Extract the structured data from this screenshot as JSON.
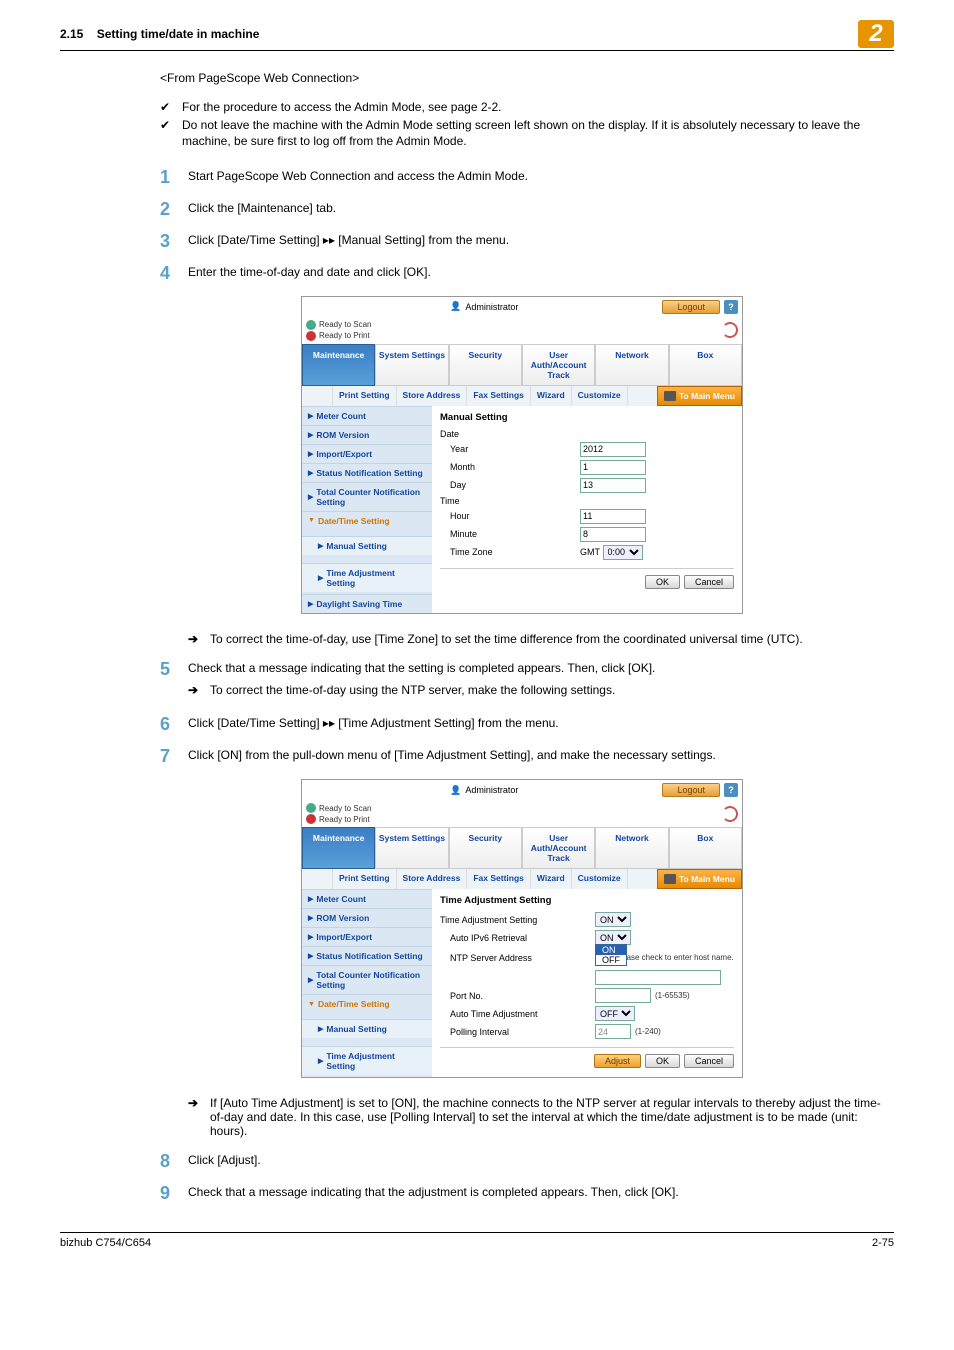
{
  "header": {
    "section_no": "2.15",
    "section_title": "Setting time/date in machine",
    "chapter": "2"
  },
  "intro": "<From PageScope Web Connection>",
  "checks": [
    "For the procedure to access the Admin Mode, see page 2-2.",
    "Do not leave the machine with the Admin Mode setting screen left shown on the display. If it is absolutely necessary to leave the machine, be sure first to log off from the Admin Mode."
  ],
  "steps": {
    "s1": "Start PageScope Web Connection and access the Admin Mode.",
    "s2": "Click the [Maintenance] tab.",
    "s3": "Click [Date/Time Setting] ▸▸ [Manual Setting] from the menu.",
    "s4": "Enter the time-of-day and date and click [OK].",
    "s4_sub": "To correct the time-of-day, use [Time Zone] to set the time difference from the coordinated universal time (UTC).",
    "s5": "Check that a message indicating that the setting is completed appears. Then, click [OK].",
    "s5_sub": "To correct the time-of-day using the NTP server, make the following settings.",
    "s6": "Click [Date/Time Setting] ▸▸ [Time Adjustment Setting] from the menu.",
    "s7": "Click [ON] from the pull-down menu of [Time Adjustment Setting], and make the necessary settings.",
    "s7_sub": "If [Auto Time Adjustment] is set to [ON], the machine connects to the NTP server at regular intervals to thereby adjust the time-of-day and date. In this case, use [Polling Interval] to set the interval at which the time/date adjustment is to be made (unit: hours).",
    "s8": "Click [Adjust].",
    "s9": "Check that a message indicating that the adjustment is completed appears. Then, click [OK]."
  },
  "ui_common": {
    "admin": "Administrator",
    "ready_scan": "Ready to Scan",
    "ready_print": "Ready to Print",
    "logout": "Logout",
    "tabs": [
      "Maintenance",
      "System Settings",
      "Security",
      "User Auth/Account Track",
      "Network",
      "Box"
    ],
    "subtabs_blank": "",
    "subtabs": [
      "Print Setting",
      "Store Address",
      "Fax Settings",
      "Wizard",
      "Customize"
    ],
    "tomain": "To Main Menu",
    "side": {
      "meter": "Meter Count",
      "rom": "ROM Version",
      "impexp": "Import/Export",
      "status": "Status Notification Setting",
      "totcnt": "Total Counter Notification Setting",
      "dts": "Date/Time Setting",
      "manual": "Manual Setting",
      "tas": "Time Adjustment Setting",
      "dst": "Daylight Saving Time"
    },
    "ok": "OK",
    "cancel": "Cancel",
    "adjust": "Adjust"
  },
  "ui1": {
    "title": "Manual Setting",
    "date": "Date",
    "year": "Year",
    "year_v": "2012",
    "month": "Month",
    "month_v": "1",
    "day": "Day",
    "day_v": "13",
    "time": "Time",
    "hour": "Hour",
    "hour_v": "11",
    "minute": "Minute",
    "minute_v": "8",
    "tz": "Time Zone",
    "tz_gmt": "GMT",
    "tz_v": "0:00"
  },
  "ui2": {
    "title": "Time Adjustment Setting",
    "tas": "Time Adjustment Setting",
    "tas_v": "ON",
    "ipv6": "Auto IPv6 Retrieval",
    "ipv6_v": "ON",
    "ipv6_opt_on": "ON",
    "ipv6_opt_off": "OFF",
    "ntp": "NTP Server Address",
    "ntp_hint": "Please check to enter host name.",
    "port": "Port No.",
    "port_hint": "(1-65535)",
    "ata": "Auto Time Adjustment",
    "ata_v": "OFF",
    "poll": "Polling Interval",
    "poll_v": "24",
    "poll_hint": "(1-240)"
  },
  "footer": {
    "model": "bizhub C754/C654",
    "page": "2-75"
  }
}
